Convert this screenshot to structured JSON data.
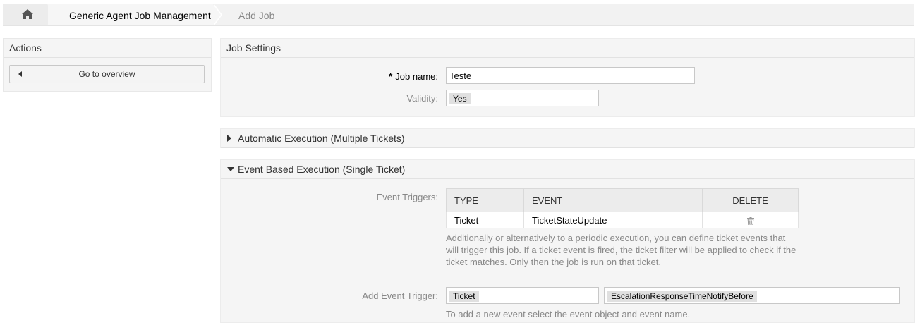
{
  "breadcrumb": {
    "home_icon": "home-icon",
    "items": [
      "Generic Agent Job Management",
      "Add Job"
    ]
  },
  "sidebar": {
    "title": "Actions",
    "overview_button": "Go to overview"
  },
  "job_settings": {
    "title": "Job Settings",
    "job_name_label": "Job name:",
    "required_mark": "*",
    "job_name_value": "Teste",
    "validity_label": "Validity:",
    "validity_value": "Yes"
  },
  "automatic_execution": {
    "title": "Automatic Execution (Multiple Tickets)",
    "expanded": false
  },
  "event_execution": {
    "title": "Event Based Execution (Single Ticket)",
    "expanded": true,
    "triggers_label": "Event Triggers:",
    "columns": [
      "TYPE",
      "EVENT",
      "DELETE"
    ],
    "rows": [
      {
        "type": "Ticket",
        "event": "TicketStateUpdate",
        "delete_icon": "trash-icon"
      }
    ],
    "help_text": "Additionally or alternatively to a periodic execution, you can define ticket events that will trigger this job. If a ticket event is fired, the ticket filter will be applied to check if the ticket matches. Only then the job is run on that ticket.",
    "add_trigger_label": "Add Event Trigger:",
    "add_object_value": "Ticket",
    "add_event_value": "EscalationResponseTimeNotifyBefore",
    "add_help_text": "To add a new event select the event object and event name."
  },
  "colors": {
    "panel_bg": "#f5f5f5",
    "header_bg": "#ececec",
    "muted_text": "#888888"
  }
}
